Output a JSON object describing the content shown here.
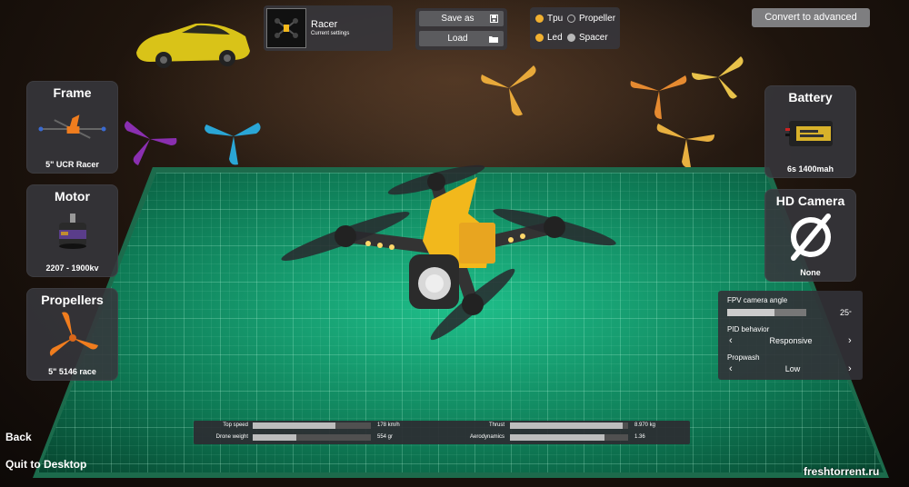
{
  "preset": {
    "name": "Racer",
    "subtitle": "Current settings"
  },
  "file_buttons": {
    "save_label": "Save as",
    "load_label": "Load"
  },
  "material_options": [
    {
      "label": "Tpu",
      "selected": true
    },
    {
      "label": "Propeller",
      "selected": false
    },
    {
      "label": "Led",
      "selected": true
    },
    {
      "label": "Spacer",
      "selected": false
    }
  ],
  "advanced_button": "Convert to advanced",
  "parts_left": [
    {
      "title": "Frame",
      "value": "5\" UCR Racer",
      "icon": "frame-icon"
    },
    {
      "title": "Motor",
      "value": "2207 - 1900kv",
      "icon": "motor-icon"
    },
    {
      "title": "Propellers",
      "value": "5\" 5146 race",
      "icon": "propeller-icon"
    }
  ],
  "parts_right": [
    {
      "title": "Battery",
      "value": "6s 1400mah",
      "icon": "battery-icon"
    },
    {
      "title": "HD Camera",
      "value": "None",
      "icon": "none-icon"
    }
  ],
  "settings": {
    "camera_angle_label": "FPV camera angle",
    "camera_angle_value": "25",
    "camera_angle_unit": "°",
    "camera_angle_fraction": 0.6,
    "pid_label": "PID behavior",
    "pid_value": "Responsive",
    "propwash_label": "Propwash",
    "propwash_value": "Low"
  },
  "stats": [
    {
      "label": "Top speed",
      "value": "178 km/h",
      "fraction": 0.7
    },
    {
      "label": "Drone weight",
      "value": "554 gr",
      "fraction": 0.37
    },
    {
      "label": "Thrust",
      "value": "8.970 kg",
      "fraction": 0.95
    },
    {
      "label": "Aerodynamics",
      "value": "1.36",
      "fraction": 0.8
    }
  ],
  "nav": {
    "back": "Back",
    "quit": "Quit to Desktop"
  },
  "watermark": "freshtorrent.ru",
  "colors": {
    "accent_orange": "#f4a024",
    "radio_selected": "#f0b030",
    "radio_unselected": "#b8b8b8",
    "mat_green": "#118a62"
  }
}
